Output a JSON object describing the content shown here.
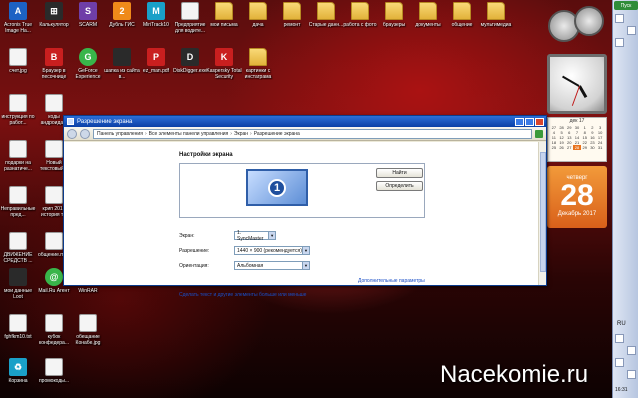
{
  "desktop_icons": [
    {
      "label": "Acronis True Image Ha...",
      "kind": "blue",
      "glyph": "A"
    },
    {
      "label": "Калькулятор",
      "kind": "dark",
      "glyph": "⊞"
    },
    {
      "label": "SCARM",
      "kind": "purple",
      "glyph": "S"
    },
    {
      "label": "Дубль ГИС",
      "kind": "orange",
      "glyph": "2"
    },
    {
      "label": "MiriTrack10",
      "kind": "teal",
      "glyph": "M"
    },
    {
      "label": "Предприятие для водите...",
      "kind": "doc",
      "glyph": ""
    },
    {
      "label": "мои письма",
      "kind": "folder",
      "glyph": ""
    },
    {
      "label": "дача",
      "kind": "folder",
      "glyph": ""
    },
    {
      "label": "ремонт",
      "kind": "folder",
      "glyph": ""
    },
    {
      "label": "Старые данн...",
      "kind": "folder",
      "glyph": ""
    },
    {
      "label": "работа с фото",
      "kind": "folder",
      "glyph": ""
    },
    {
      "label": "браузеры",
      "kind": "folder",
      "glyph": ""
    },
    {
      "label": "документы",
      "kind": "folder",
      "glyph": ""
    },
    {
      "label": "общение",
      "kind": "folder",
      "glyph": ""
    },
    {
      "label": "мультимедиа",
      "kind": "folder",
      "glyph": ""
    },
    {
      "label": "счет.jpg",
      "kind": "doc",
      "glyph": ""
    },
    {
      "label": "Браузер в песочнице",
      "kind": "red",
      "glyph": "B"
    },
    {
      "label": "GeForce Experience",
      "kind": "green",
      "glyph": "G"
    },
    {
      "label": "шапка из сайта в...",
      "kind": "dark",
      "glyph": ""
    },
    {
      "label": "ez_man.pdf",
      "kind": "red",
      "glyph": "P"
    },
    {
      "label": "DiskDigger.exe",
      "kind": "dark",
      "glyph": "D"
    },
    {
      "label": "Kaspersky Total Security",
      "kind": "red",
      "glyph": "K"
    },
    {
      "label": "картинки с инстаграма",
      "kind": "folder",
      "glyph": ""
    },
    {
      "label": "инструкция по работ...",
      "kind": "doc",
      "glyph": ""
    },
    {
      "label": "коды андроида...",
      "kind": "doc",
      "glyph": ""
    },
    {
      "label": "подарки на разнатиче...",
      "kind": "doc",
      "glyph": ""
    },
    {
      "label": "Новый текстовый...",
      "kind": "doc",
      "glyph": ""
    },
    {
      "label": "Неправильные пред...",
      "kind": "doc",
      "glyph": ""
    },
    {
      "label": "крип 2016 история т...",
      "kind": "doc",
      "glyph": ""
    },
    {
      "label": "ДВИЖЕНИЕ СРЕДСТВ ...",
      "kind": "doc",
      "glyph": ""
    },
    {
      "label": "общение.mdb",
      "kind": "doc",
      "glyph": ""
    },
    {
      "label": "мои данные Loot",
      "kind": "dark",
      "glyph": ""
    },
    {
      "label": "Mail.Ru Агент",
      "kind": "green",
      "glyph": "@"
    },
    {
      "label": "WinRAR",
      "kind": "purple",
      "glyph": ""
    },
    {
      "label": "fghfkm10.txt",
      "kind": "doc",
      "glyph": ""
    },
    {
      "label": "кубок конфедера...",
      "kind": "doc",
      "glyph": ""
    },
    {
      "label": "обещание Конабе.jpg",
      "kind": "doc",
      "glyph": ""
    },
    {
      "label": "Корзина",
      "kind": "teal",
      "glyph": "♻"
    },
    {
      "label": "промокоды...",
      "kind": "doc",
      "glyph": ""
    }
  ],
  "window": {
    "title": "Разрешение экрана",
    "breadcrumb": [
      "Панель управления",
      "Все элементы панели управления",
      "Экран",
      "Разрешение экрана"
    ],
    "heading": "Настройки экрана",
    "monitor_number": "1",
    "find_button": "Найти",
    "identify_button": "Определить",
    "screen_label": "Экран:",
    "screen_value": "1. SyncMaster",
    "resolution_label": "Разрешение:",
    "resolution_value": "1440 × 900 (рекомендуется)",
    "orientation_label": "Ориентация:",
    "orientation_value": "Альбомная",
    "advanced_link": "Дополнительные параметры",
    "text_size_link": "Сделать текст и другие элементы больше или меньше"
  },
  "widgets": {
    "calendar_month": "дек 17",
    "calendar_days": [
      "27",
      "28",
      "29",
      "30",
      "1",
      "2",
      "3",
      "4",
      "5",
      "6",
      "7",
      "8",
      "9",
      "10",
      "11",
      "12",
      "13",
      "14",
      "15",
      "16",
      "17",
      "18",
      "19",
      "20",
      "21",
      "22",
      "23",
      "24",
      "25",
      "26",
      "27",
      "28",
      "29",
      "30",
      "31"
    ],
    "today": "28",
    "big_dow": "четверг",
    "big_day": "28",
    "big_month": "Декабрь 2017"
  },
  "taskbar": {
    "start_label": "Пуск",
    "lang": "RU",
    "time": "16:31"
  },
  "watermark": "Nacekomie.ru",
  "colors": {
    "title_bar": "#0a3fa6",
    "link": "#1a4fc7",
    "calendar_accent": "#e8731e"
  }
}
